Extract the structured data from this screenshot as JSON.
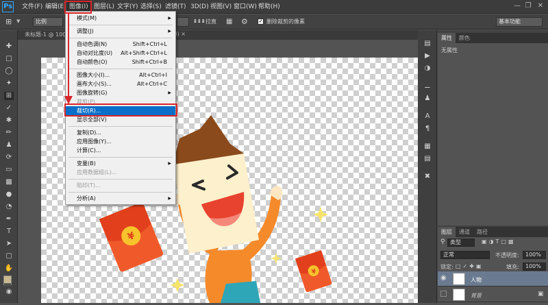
{
  "app": {
    "logo": "Ps"
  },
  "menubar": {
    "items": [
      "文件(F)",
      "编辑(E)",
      "图像(I)",
      "图层(L)",
      "文字(Y)",
      "选择(S)",
      "滤镜(T)",
      "3D(D)",
      "视图(V)",
      "窗口(W)",
      "帮助(H)"
    ],
    "active": "图像(I)"
  },
  "options_bar": {
    "ratio": "比例",
    "straighten": "拉直",
    "delete_cropped": "删除裁剪的像素",
    "workspace": "基本功能"
  },
  "document": {
    "tab_title": "未标题-1 @ 100%"
  },
  "image_menu": {
    "items": [
      {
        "label": "模式(M)",
        "shortcut": "",
        "submenu": true,
        "disabled": false
      },
      {
        "label": "调整(J)",
        "shortcut": "",
        "submenu": true,
        "disabled": false
      },
      {
        "label": "自动色调(N)",
        "shortcut": "Shift+Ctrl+L",
        "submenu": false,
        "disabled": false
      },
      {
        "label": "自动对比度(U)",
        "shortcut": "Alt+Shift+Ctrl+L",
        "submenu": false,
        "disabled": false
      },
      {
        "label": "自动颜色(O)",
        "shortcut": "Shift+Ctrl+B",
        "submenu": false,
        "disabled": false
      },
      {
        "label": "图像大小(I)...",
        "shortcut": "Alt+Ctrl+I",
        "submenu": false,
        "disabled": false
      },
      {
        "label": "画布大小(S)...",
        "shortcut": "Alt+Ctrl+C",
        "submenu": false,
        "disabled": false
      },
      {
        "label": "图像旋转(G)",
        "shortcut": "",
        "submenu": true,
        "disabled": false
      },
      {
        "label": "裁剪(P)",
        "shortcut": "",
        "submenu": false,
        "disabled": true
      },
      {
        "label": "裁切(R)...",
        "shortcut": "",
        "submenu": false,
        "disabled": false,
        "highlighted": true
      },
      {
        "label": "显示全部(V)",
        "shortcut": "",
        "submenu": false,
        "disabled": false
      },
      {
        "label": "复制(D)...",
        "shortcut": "",
        "submenu": false,
        "disabled": false
      },
      {
        "label": "应用图像(Y)...",
        "shortcut": "",
        "submenu": false,
        "disabled": false
      },
      {
        "label": "计算(C)...",
        "shortcut": "",
        "submenu": false,
        "disabled": false
      },
      {
        "label": "变量(B)",
        "shortcut": "",
        "submenu": true,
        "disabled": false
      },
      {
        "label": "应用数据组(L)...",
        "shortcut": "",
        "submenu": false,
        "disabled": true
      },
      {
        "label": "陷印(T)...",
        "shortcut": "",
        "submenu": false,
        "disabled": true
      },
      {
        "label": "分析(A)",
        "shortcut": "",
        "submenu": true,
        "disabled": false
      }
    ]
  },
  "properties_panel": {
    "tabs": [
      "属性",
      "颜色"
    ],
    "content": "无属性"
  },
  "layers_panel": {
    "tabs": [
      "图层",
      "通道",
      "路径"
    ],
    "filter": "类型",
    "blend_mode": "正常",
    "opacity_label": "不透明度:",
    "opacity": "100%",
    "lock_label": "锁定:",
    "fill_label": "填充:",
    "fill": "100%",
    "layers": [
      {
        "name": "人物",
        "selected": true
      },
      {
        "name": "背景",
        "selected": false
      }
    ]
  },
  "colors": {
    "accent": "#d8262b",
    "highlight": "#0a6fc8"
  }
}
